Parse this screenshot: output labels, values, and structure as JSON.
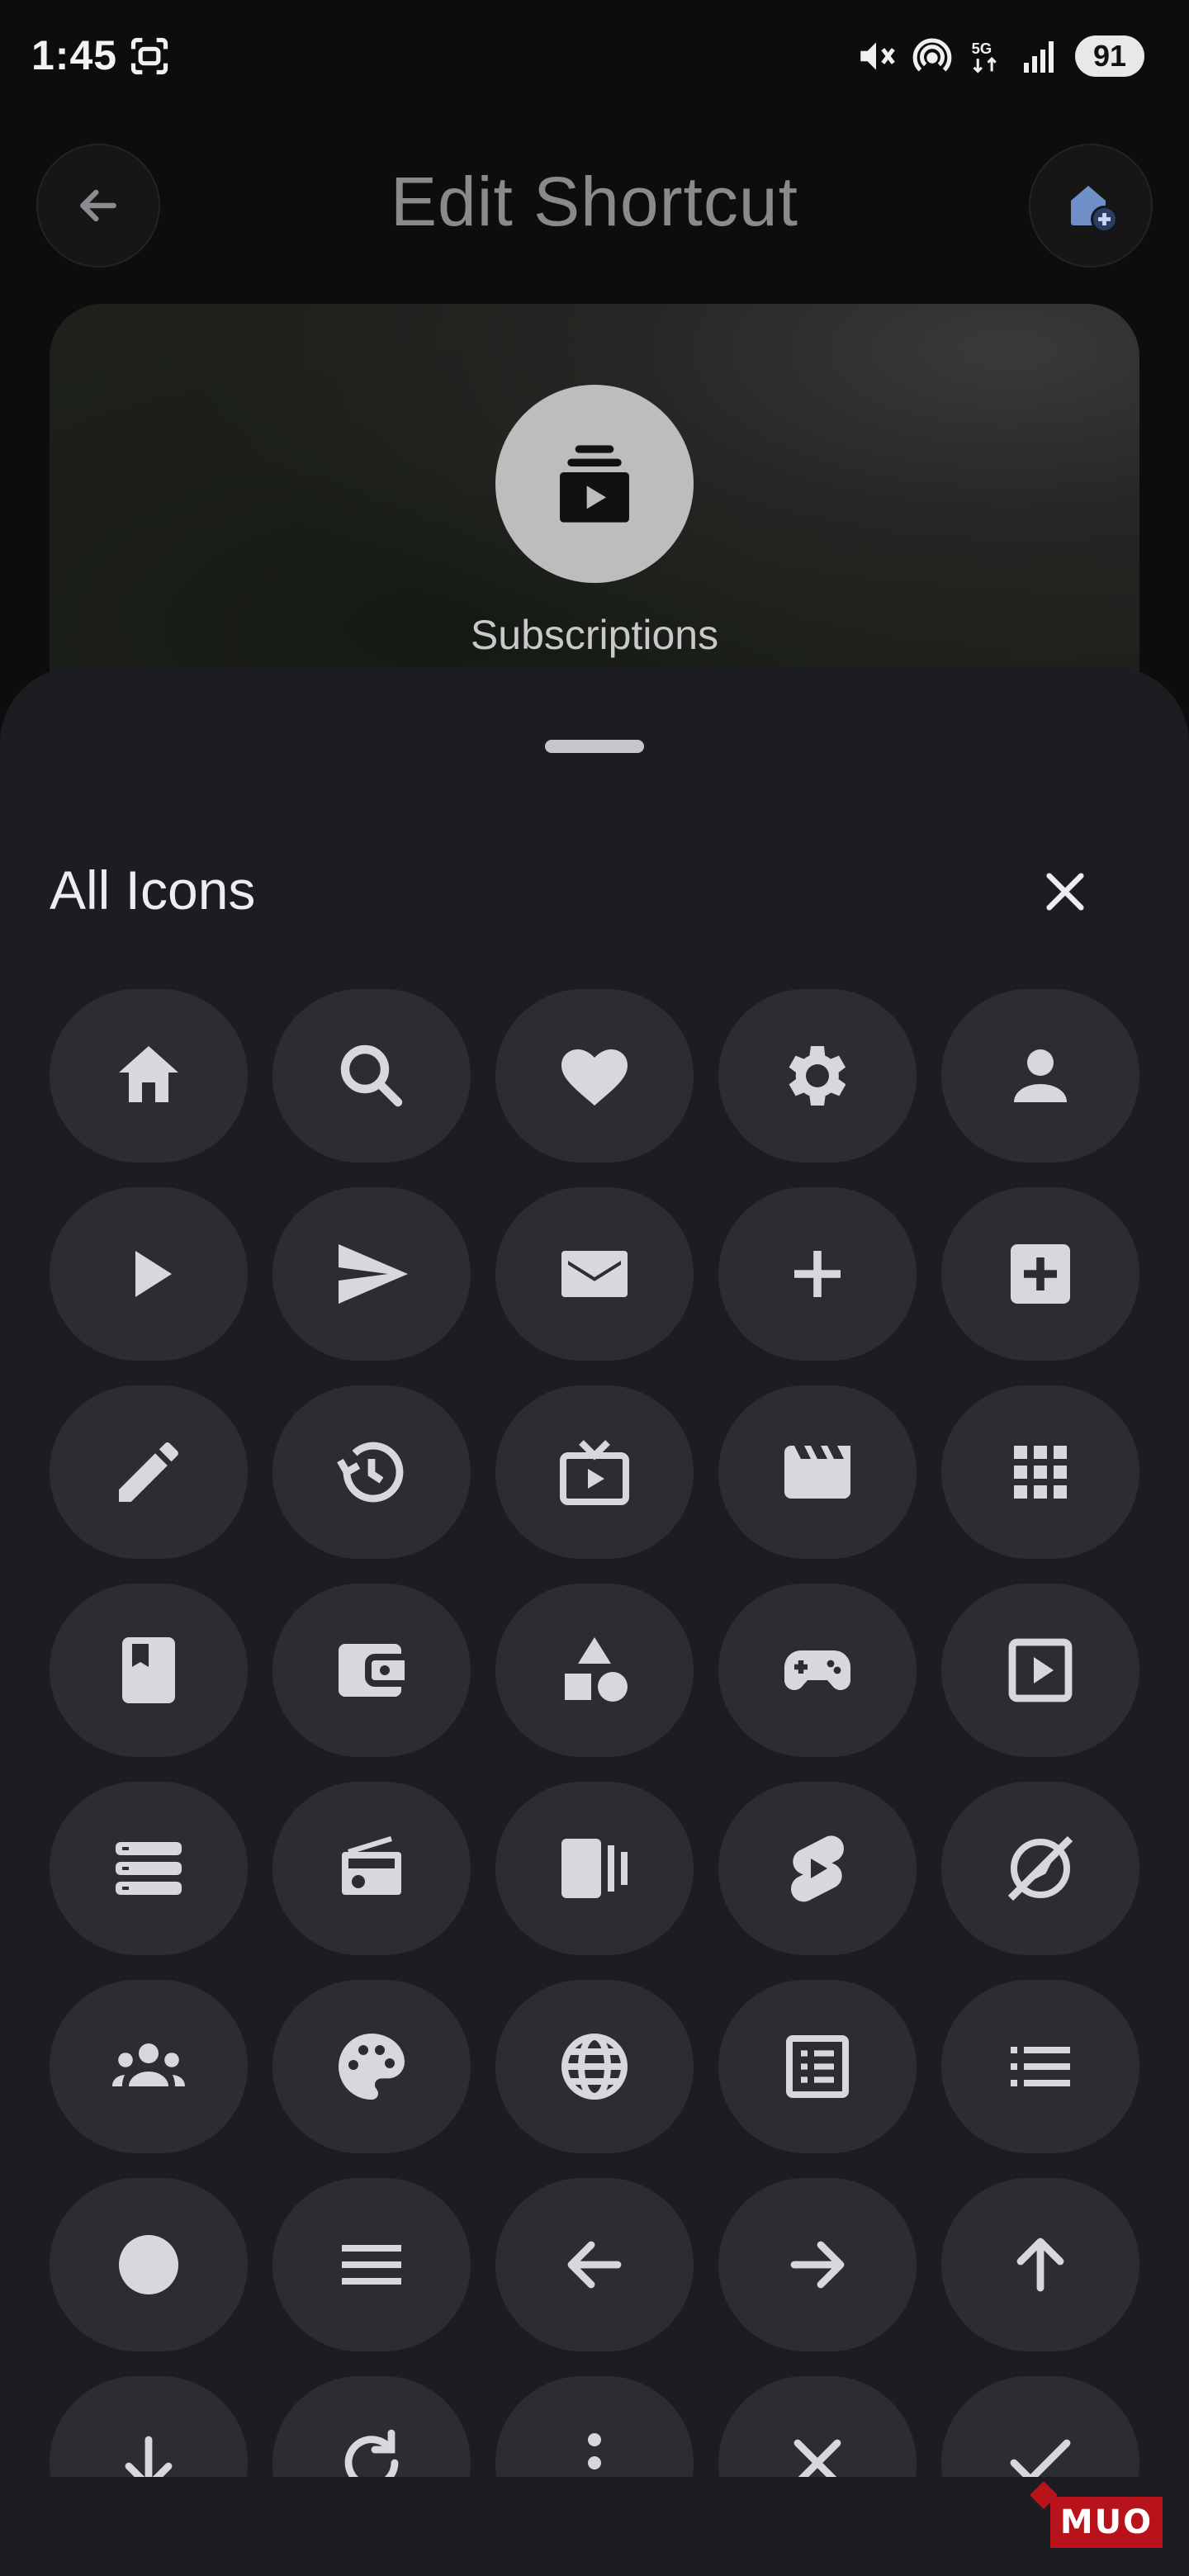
{
  "status_bar": {
    "time": "1:45",
    "network": "5G",
    "battery": "91"
  },
  "header": {
    "title": "Edit Shortcut",
    "back_icon": "arrow-back-icon",
    "action_icon": "add-to-home-icon"
  },
  "preview": {
    "icon": "subscriptions-icon",
    "label": "Subscriptions"
  },
  "sheet": {
    "title": "All Icons",
    "close_icon": "close-icon",
    "icons": [
      "home-icon",
      "search-icon",
      "heart-icon",
      "settings-icon",
      "person-icon",
      "play-icon",
      "send-icon",
      "mail-icon",
      "add-icon",
      "add-box-icon",
      "edit-icon",
      "history-icon",
      "live-tv-icon",
      "movie-icon",
      "apps-icon",
      "book-icon",
      "wallet-icon",
      "category-icon",
      "gamepad-icon",
      "slideshow-icon",
      "storage-icon",
      "radio-icon",
      "video-library-icon",
      "shorts-icon",
      "explore-off-icon",
      "groups-icon",
      "palette-icon",
      "globe-icon",
      "article-icon",
      "list-icon",
      "circle-icon",
      "menu-icon",
      "arrow-back-icon",
      "arrow-forward-icon",
      "arrow-upward-icon",
      "arrow-downward-icon",
      "refresh-icon",
      "more-vert-icon",
      "close-icon",
      "check-icon"
    ]
  },
  "watermark": "MUO",
  "colors": {
    "background": "#0d0d0e",
    "sheet": "#1c1d21",
    "tile": "#2c2d32",
    "icon": "#d8d8dc",
    "watermark": "#b8121b"
  }
}
